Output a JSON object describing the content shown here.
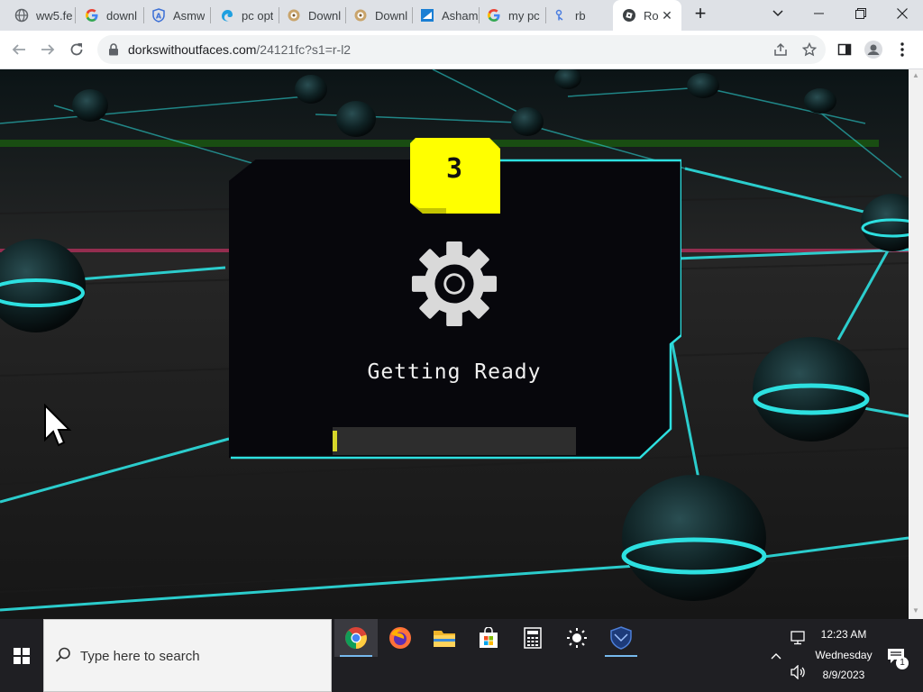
{
  "browser": {
    "tabs": [
      {
        "title": "ww5.fe",
        "icon": "globe-icon"
      },
      {
        "title": "downl",
        "icon": "google-icon"
      },
      {
        "title": "Asmw",
        "icon": "shield-a-icon"
      },
      {
        "title": "pc opt",
        "icon": "edge-icon"
      },
      {
        "title": "Downl",
        "icon": "download-site-icon"
      },
      {
        "title": "Downl",
        "icon": "download-site-icon"
      },
      {
        "title": "Asham",
        "icon": "ashampoo-icon"
      },
      {
        "title": "my pc",
        "icon": "google-icon"
      },
      {
        "title": "rb",
        "icon": "rb-icon"
      },
      {
        "title": "Ro",
        "icon": "roblox-icon",
        "active": true
      }
    ],
    "new_tab_label": "+",
    "url_host": "dorkswithoutfaces.com",
    "url_path": "/24121fc?s1=r-l2"
  },
  "modal": {
    "countdown": "3",
    "title": "Getting Ready",
    "progress_percent": 2
  },
  "taskbar": {
    "search_placeholder": "Type here to search",
    "apps": [
      "chrome-icon",
      "firefox-icon",
      "file-explorer-icon",
      "store-icon",
      "calculator-icon",
      "brightness-icon",
      "defender-shield-icon"
    ],
    "time": "12:23 AM",
    "day": "Wednesday",
    "date": "8/9/2023",
    "notification_count": "1"
  },
  "colors": {
    "accent_cyan": "#2de0e0",
    "badge_yellow": "#ffff00",
    "modal_bg": "#07070c",
    "progress_fill": "#d6d62a"
  }
}
